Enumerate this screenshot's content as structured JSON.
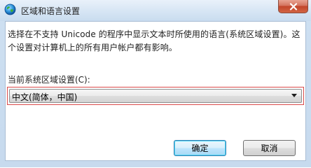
{
  "window": {
    "title": "区域和语言设置",
    "icon": "globe-icon",
    "close_icon": "close-icon"
  },
  "content": {
    "description": "选择在不支持 Unicode 的程序中显示文本时所使用的语言(系统区域设置)。这个设置对计算机上的所有用户帐户都有影响。",
    "current_locale_label": "当前系统区域设置(C):",
    "current_locale_value": "中文(简体，中国)"
  },
  "buttons": {
    "ok": "确定",
    "cancel": "取消"
  },
  "colors": {
    "highlight_border": "#d94a4a",
    "close_button": "#c2442a",
    "default_button_border": "#3c7fb1"
  }
}
